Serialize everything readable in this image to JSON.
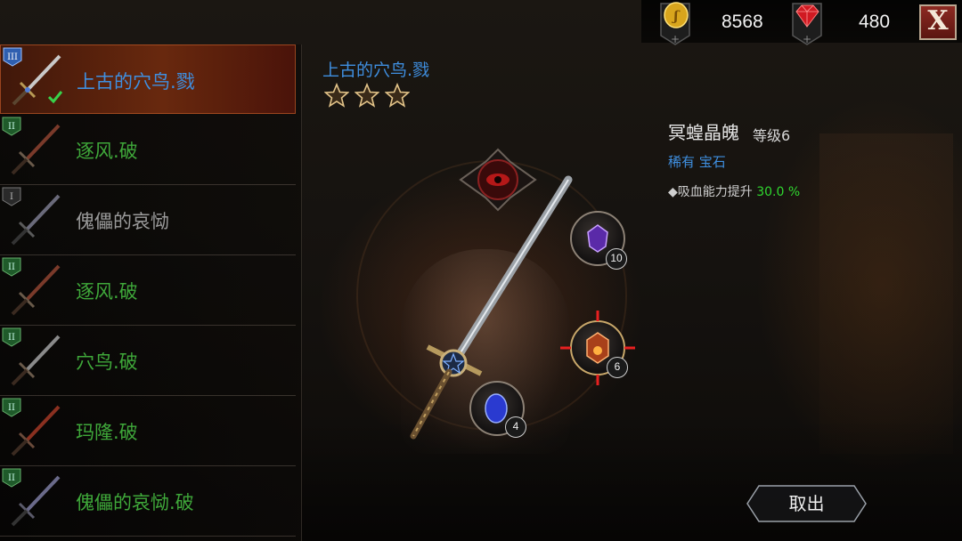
{
  "currency": {
    "gold": {
      "icon": "gold-coin-icon",
      "value": "8568"
    },
    "gems": {
      "icon": "red-gem-icon",
      "value": "480"
    },
    "close_label": "X"
  },
  "weapon_list": [
    {
      "tier": "III",
      "name": "上古的穴鸟.戮",
      "color": "#3f8fe0",
      "selected": true,
      "checked": true
    },
    {
      "tier": "II",
      "name": "逐风.破",
      "color": "#3fa83a",
      "selected": false
    },
    {
      "tier": "I",
      "name": "傀儡的哀恸",
      "color": "#9a9a9a",
      "selected": false
    },
    {
      "tier": "II",
      "name": "逐风.破",
      "color": "#3fa83a",
      "selected": false
    },
    {
      "tier": "II",
      "name": "穴鸟.破",
      "color": "#3fa83a",
      "selected": false
    },
    {
      "tier": "II",
      "name": "玛隆.破",
      "color": "#3fa83a",
      "selected": false
    },
    {
      "tier": "II",
      "name": "傀儡的哀恸.破",
      "color": "#3fa83a",
      "selected": false
    }
  ],
  "detail": {
    "weapon_name": "上古的穴鸟.戮",
    "stars": 3,
    "sockets": [
      {
        "gem": "purple-gem",
        "count": "10"
      },
      {
        "gem": "orange-gem",
        "count": "6"
      },
      {
        "gem": "blue-gem",
        "count": "4"
      }
    ]
  },
  "gem_info": {
    "name": "冥蝗晶魄",
    "level": "等级6",
    "rarity": "稀有 宝石",
    "stat_label": "◆吸血能力提升",
    "stat_value": "30.0 %"
  },
  "actions": {
    "remove_label": "取出"
  },
  "colors": {
    "accent_blue": "#3f8fe0",
    "green": "#3fa83a",
    "stat_green": "#2fd72f"
  }
}
